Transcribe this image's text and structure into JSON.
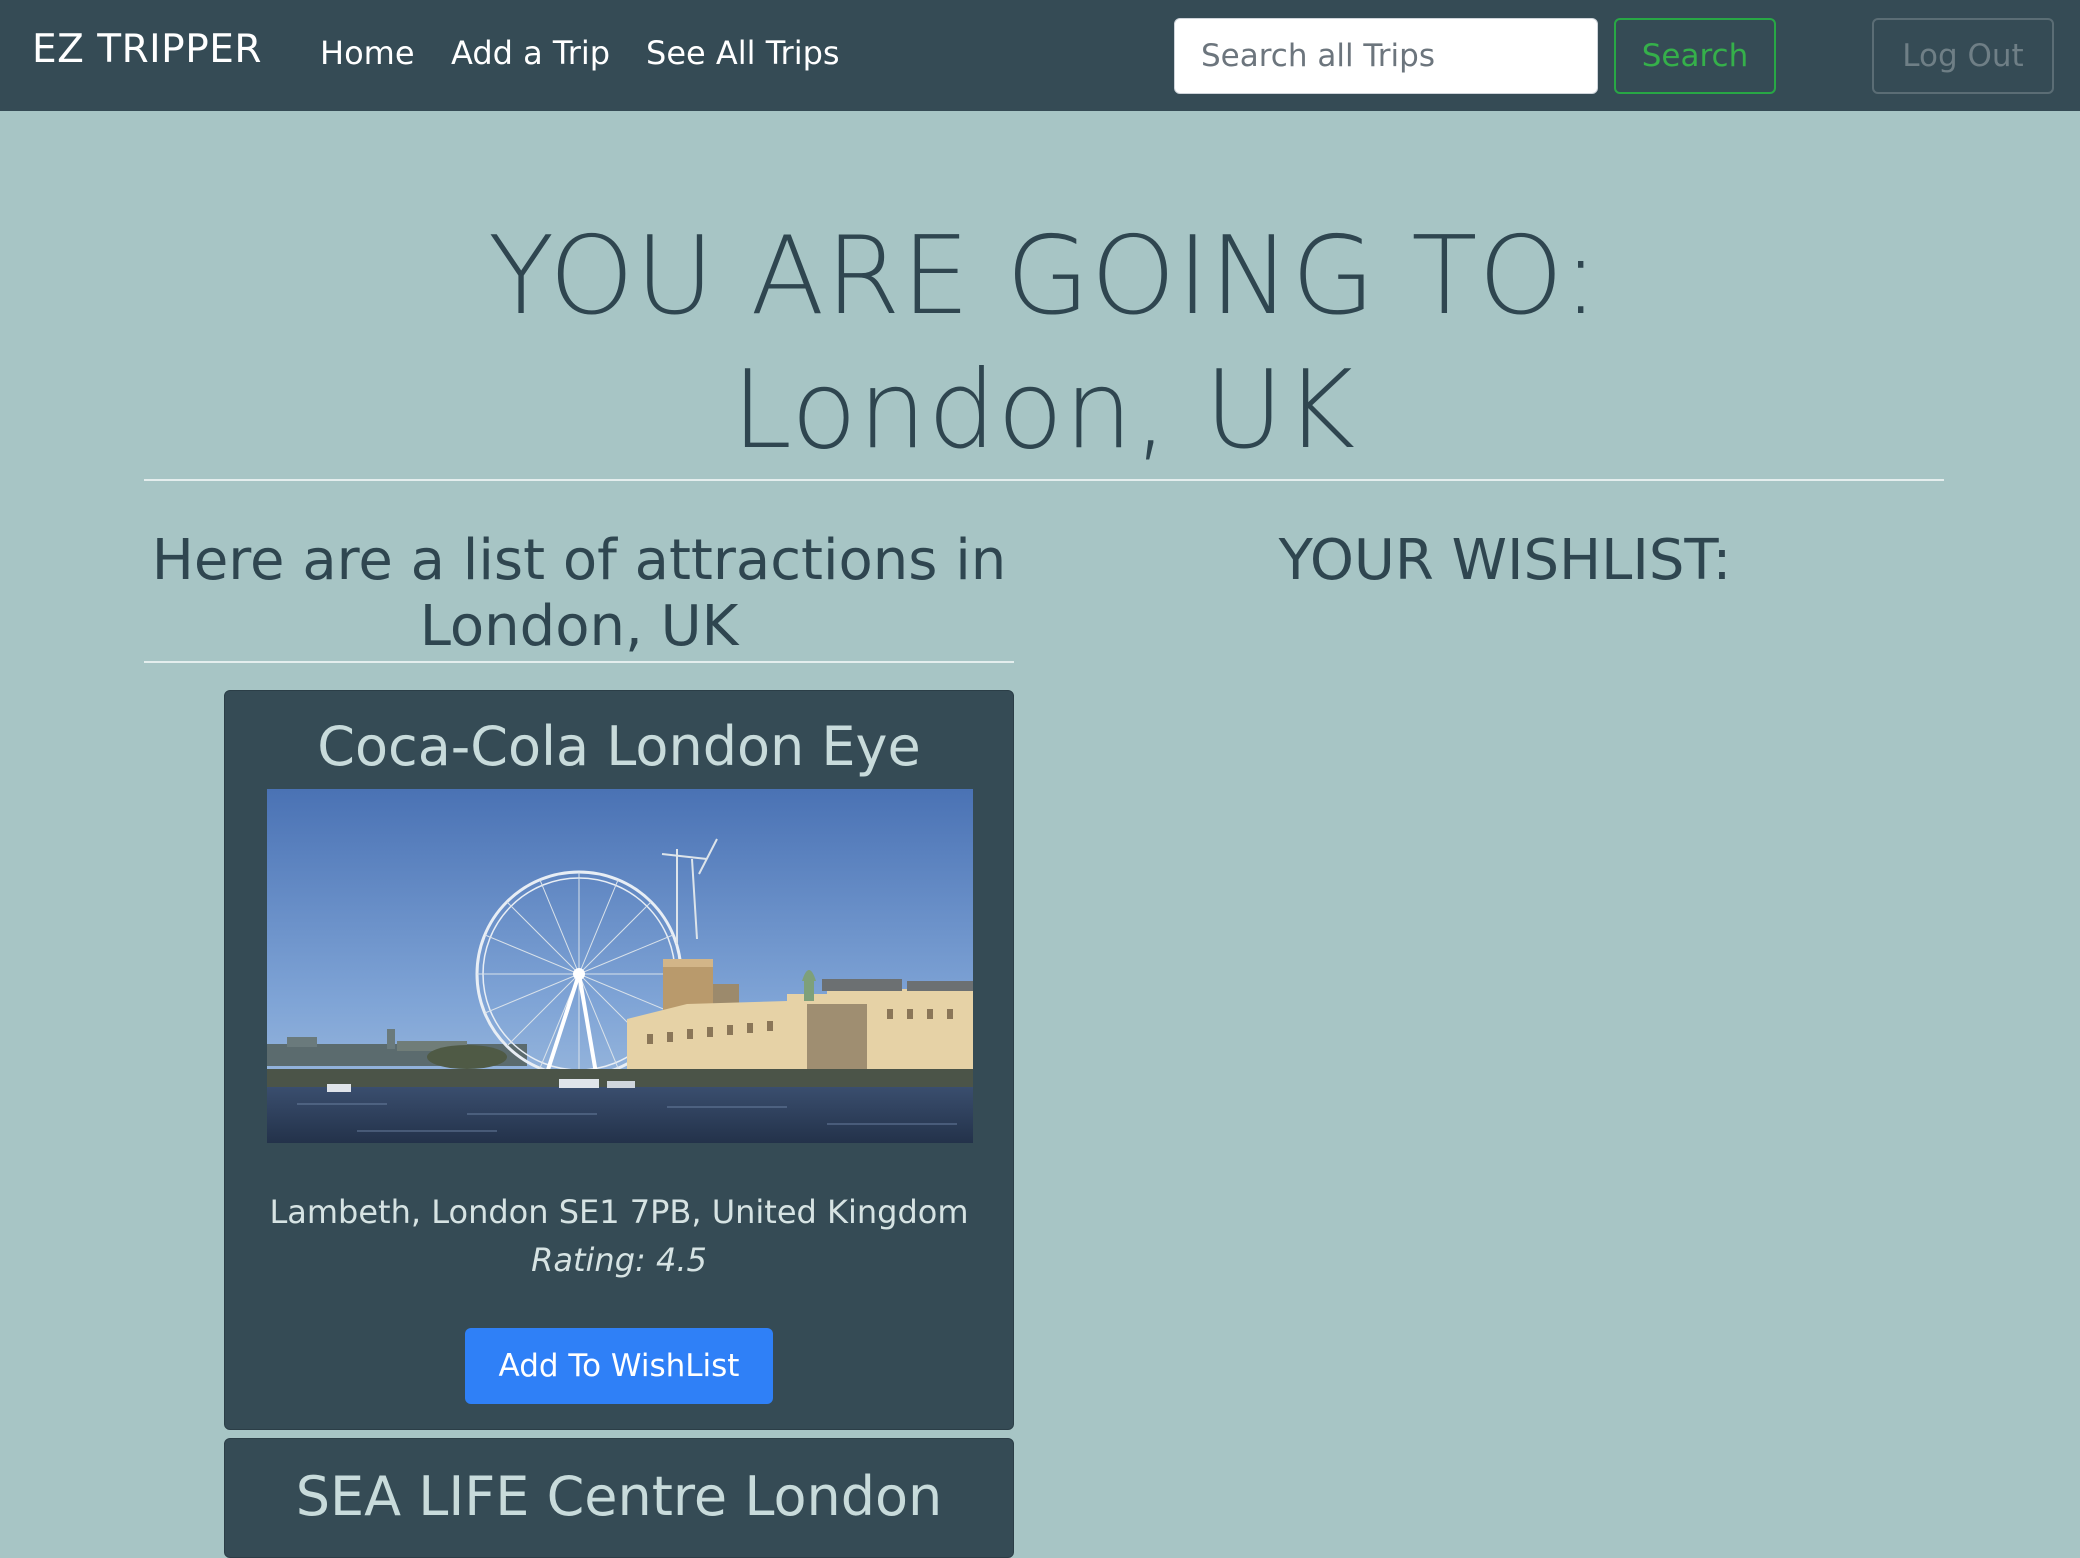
{
  "nav": {
    "brand": "EZ TRIPPER",
    "links": [
      "Home",
      "Add a Trip",
      "See All Trips"
    ],
    "search_placeholder": "Search all Trips",
    "search_label": "Search",
    "logout_label": "Log Out"
  },
  "hero": {
    "line1": "YOU ARE GOING TO:",
    "line2": "London, UK"
  },
  "attractions_heading": "Here are a list of attractions in London, UK",
  "wishlist_heading": "YOUR WISHLIST:",
  "attractions": [
    {
      "name": "Coca-Cola London Eye",
      "address": "Lambeth, London SE1 7PB, United Kingdom",
      "rating": "Rating: 4.5",
      "button": "Add To WishList"
    },
    {
      "name": "SEA LIFE Centre London"
    }
  ],
  "colors": {
    "page_bg": "#a7c5c5",
    "navbar_bg": "#354b55",
    "card_bg": "#354b55",
    "search_green": "#28a745",
    "primary_blue": "#2f80f7"
  }
}
